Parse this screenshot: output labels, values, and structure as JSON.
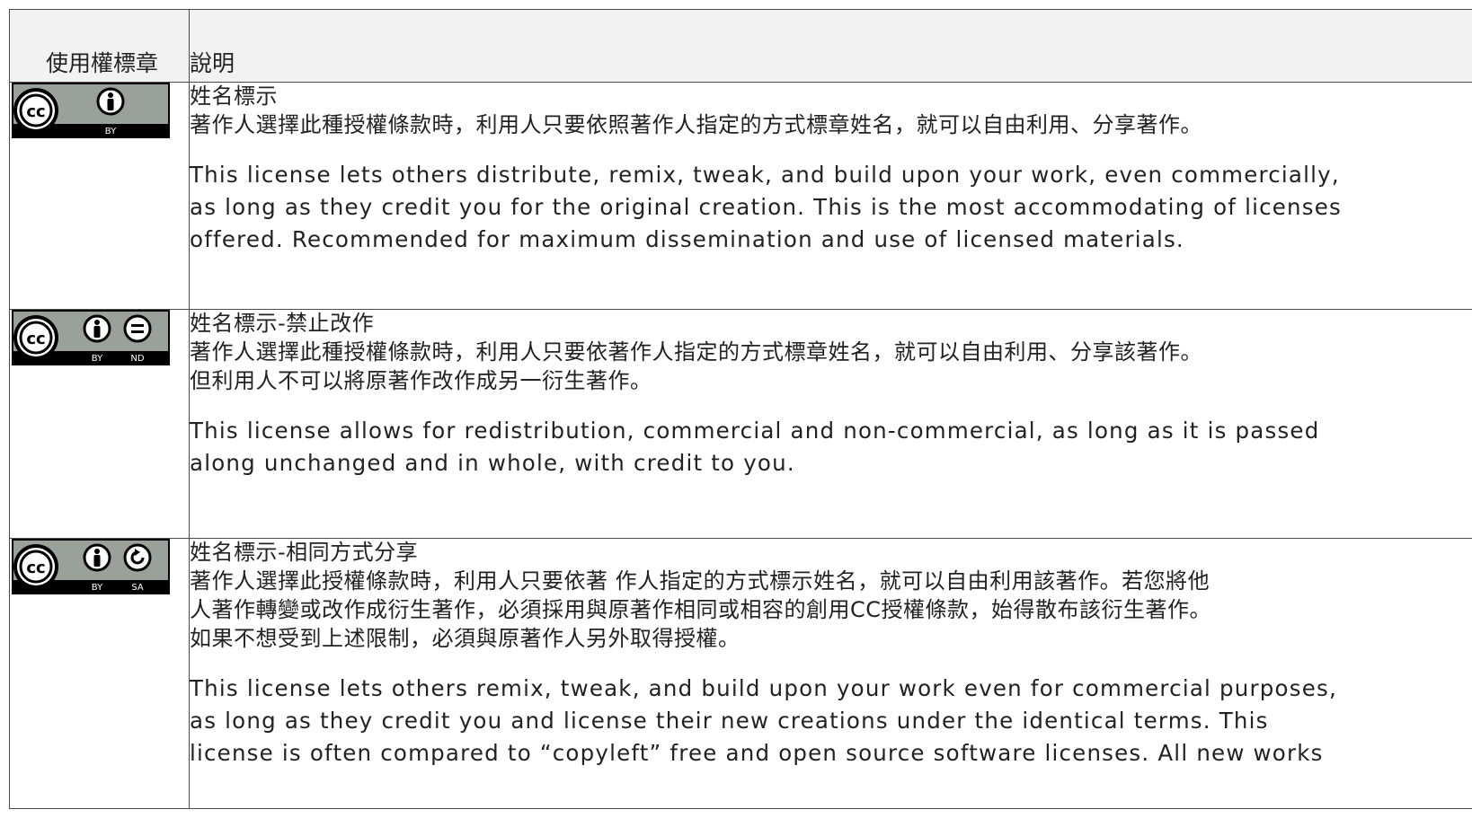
{
  "table": {
    "header_badge": "使用權標章",
    "header_desc": "說明"
  },
  "licenses": [
    {
      "icons": [
        "cc-icon",
        "by-icon"
      ],
      "badge_labels": [
        "BY"
      ],
      "title_zh": "姓名標示",
      "desc_zh": "著作人選擇此種授權條款時，利用人只要依照著作人指定的方式標章姓名，就可以自由利用、分享著作。",
      "desc_en": "This license lets others distribute, remix, tweak, and build upon your work, even commercially,\nas long as they credit you for the original creation. This is the most accommodating of licenses\noffered. Recommended for maximum dissemination and use of licensed materials."
    },
    {
      "icons": [
        "cc-icon",
        "by-icon",
        "nd-icon"
      ],
      "badge_labels": [
        "BY",
        "ND"
      ],
      "title_zh": "姓名標示-禁止改作",
      "desc_zh": "著作人選擇此種授權條款時，利用人只要依著作人指定的方式標章姓名，就可以自由利用、分享該著作。\n但利用人不可以將原著作改作成另一衍生著作。",
      "desc_en": "This license allows for redistribution, commercial and non-commercial, as long as it is passed\nalong unchanged and in whole, with credit to you."
    },
    {
      "icons": [
        "cc-icon",
        "by-icon",
        "sa-icon"
      ],
      "badge_labels": [
        "BY",
        "SA"
      ],
      "title_zh": "姓名標示-相同方式分享",
      "desc_zh": "著作人選擇此授權條款時，利用人只要依著 作人指定的方式標示姓名，就可以自由利用該著作。若您將他\n人著作轉變或改作成衍生著作，必須採用與原著作相同或相容的創用CC授權條款，始得散布該衍生著作。\n如果不想受到上述限制，必須與原著作人另外取得授權。",
      "desc_en": "This license lets others remix, tweak, and build upon your work even for commercial purposes,\nas long as they credit you and license their new creations under the identical terms. This\nlicense is often compared to “copyleft” free and open source software licenses. All new works"
    }
  ],
  "colors": {
    "badge_bg": "#9aa09a",
    "badge_dark": "#000000",
    "border": "#4a4a4a",
    "header_bg": "#f2f2f2"
  }
}
